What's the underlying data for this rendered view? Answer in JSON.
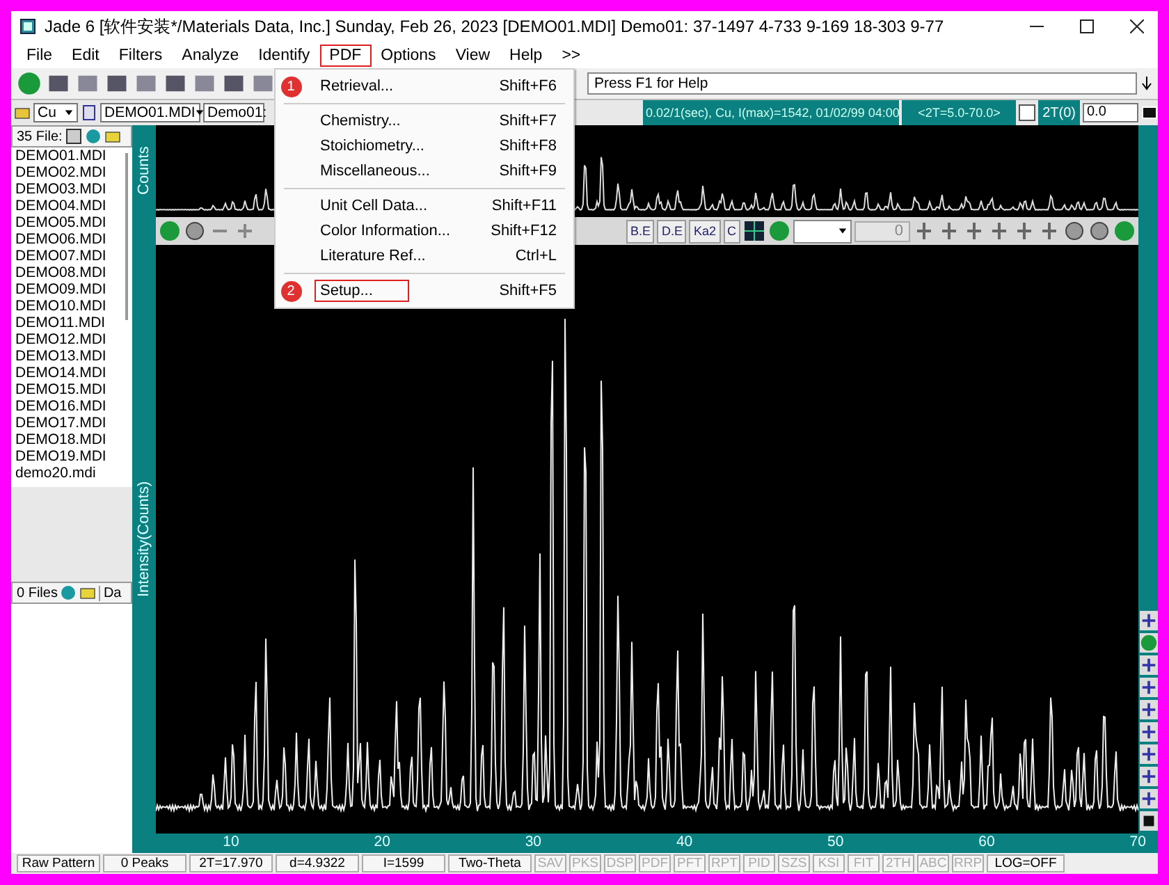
{
  "window": {
    "title": "Jade 6 [软件安装*/Materials Data, Inc.] Sunday, Feb 26, 2023 [DEMO01.MDI] Demo01: 37-1497 4-733 9-169 18-303 9-77"
  },
  "menu": [
    {
      "label": "File",
      "selected": false
    },
    {
      "label": "Edit",
      "selected": false
    },
    {
      "label": "Filters",
      "selected": false
    },
    {
      "label": "Analyze",
      "selected": false
    },
    {
      "label": "Identify",
      "selected": false
    },
    {
      "label": "PDF",
      "selected": true
    },
    {
      "label": "Options",
      "selected": false
    },
    {
      "label": "View",
      "selected": false
    },
    {
      "label": "Help",
      "selected": false
    },
    {
      "label": ">>",
      "selected": false
    }
  ],
  "open_menu": [
    {
      "kind": "item",
      "label": "Retrieval...",
      "shortcut": "Shift+F6",
      "badge": "1",
      "outlined": false
    },
    {
      "kind": "separator"
    },
    {
      "kind": "item",
      "label": "Chemistry...",
      "shortcut": "Shift+F7",
      "outlined": false
    },
    {
      "kind": "item",
      "label": "Stoichiometry...",
      "shortcut": "Shift+F8",
      "outlined": false
    },
    {
      "kind": "item",
      "label": "Miscellaneous...",
      "shortcut": "Shift+F9",
      "outlined": false
    },
    {
      "kind": "separator"
    },
    {
      "kind": "item",
      "label": "Unit Cell Data...",
      "shortcut": "Shift+F11",
      "outlined": false
    },
    {
      "kind": "item",
      "label": "Color Information...",
      "shortcut": "Shift+F12",
      "outlined": false
    },
    {
      "kind": "item",
      "label": "Literature Ref...",
      "shortcut": "Ctrl+L",
      "outlined": false
    },
    {
      "kind": "separator"
    },
    {
      "kind": "item",
      "label": "Setup...",
      "shortcut": "Shift+F5",
      "badge": "2",
      "outlined": true
    }
  ],
  "toolbar": {
    "help_text": "Press F1 for Help"
  },
  "info_bar": {
    "radiation": "Cu",
    "file": "DEMO01.MDI",
    "sample": "Demo01:",
    "scan_info": "0.02/1(sec), Cu, I(max)=1542, 01/02/99 04:00",
    "range": "<2T=5.0-70.0>",
    "zero_label": "2T(0)",
    "zero_checked": false,
    "zero_value": "0.0"
  },
  "files": {
    "count": "35 File:",
    "items": [
      "DEMO01.MDI",
      "DEMO02.MDI",
      "DEMO03.MDI",
      "DEMO04.MDI",
      "DEMO05.MDI",
      "DEMO06.MDI",
      "DEMO07.MDI",
      "DEMO08.MDI",
      "DEMO09.MDI",
      "DEMO10.MDI",
      "DEMO11.MDI",
      "DEMO12.MDI",
      "DEMO13.MDI",
      "DEMO14.MDI",
      "DEMO15.MDI",
      "DEMO16.MDI",
      "DEMO17.MDI",
      "DEMO18.MDI",
      "DEMO19.MDI",
      "demo20.mdi"
    ]
  },
  "second_files": {
    "count": "0 Files",
    "column_2": "Da"
  },
  "plot": {
    "top_label": "Counts",
    "y_label": "Intensity(Counts)",
    "x_ticks": [
      "10",
      "20",
      "30",
      "40",
      "50",
      "60",
      "70"
    ]
  },
  "plot_toolbar": {
    "buttons": [
      "B.E",
      "D.E",
      "Ka2",
      "C"
    ],
    "field_value": "0"
  },
  "status_bar": [
    {
      "text": "Raw Pattern",
      "disabled": false
    },
    {
      "text": "0 Peaks",
      "disabled": false
    },
    {
      "text": "2T=17.970",
      "disabled": false
    },
    {
      "text": "d=4.9322",
      "disabled": false
    },
    {
      "text": "I=1599",
      "disabled": false
    },
    {
      "text": "Two-Theta",
      "disabled": false
    },
    {
      "text": "SAV",
      "disabled": true
    },
    {
      "text": "PKS",
      "disabled": true
    },
    {
      "text": "DSP",
      "disabled": true
    },
    {
      "text": "PDF",
      "disabled": true
    },
    {
      "text": "PFT",
      "disabled": true
    },
    {
      "text": "RPT",
      "disabled": true
    },
    {
      "text": "PID",
      "disabled": true
    },
    {
      "text": "SZS",
      "disabled": true
    },
    {
      "text": "KSI",
      "disabled": true
    },
    {
      "text": "FIT",
      "disabled": true
    },
    {
      "text": "2TH",
      "disabled": true
    },
    {
      "text": "ABC",
      "disabled": true
    },
    {
      "text": "RRP",
      "disabled": true
    },
    {
      "text": "LOG=OFF",
      "disabled": false
    }
  ]
}
